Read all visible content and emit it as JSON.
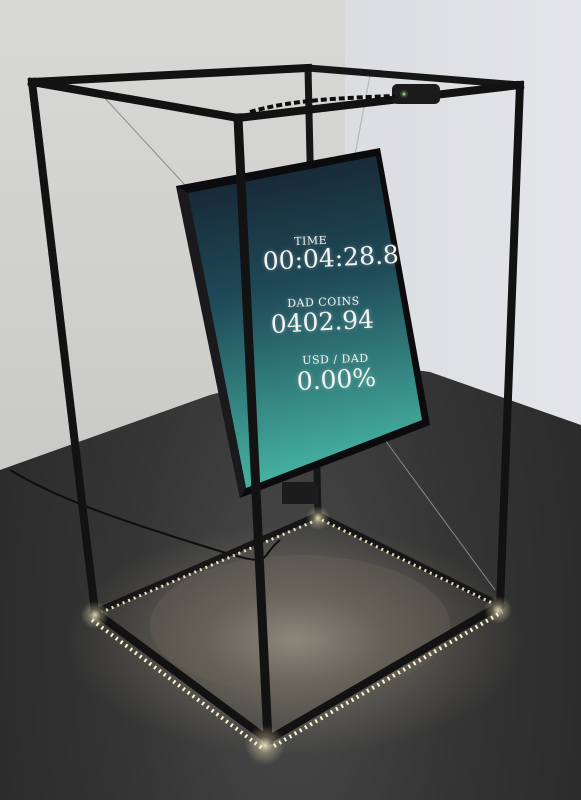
{
  "monitor": {
    "time_label": "TIME",
    "time_value": "00:04:28.8",
    "coins_label": "DAD COINS",
    "coins_value": "0402.94",
    "rate_label": "USD / DAD",
    "rate_value": "0.00%"
  },
  "colors": {
    "frame": "#141414",
    "screen_top": "#1b2a3a",
    "screen_bottom": "#3fa89a",
    "led": "#fff3cf"
  }
}
